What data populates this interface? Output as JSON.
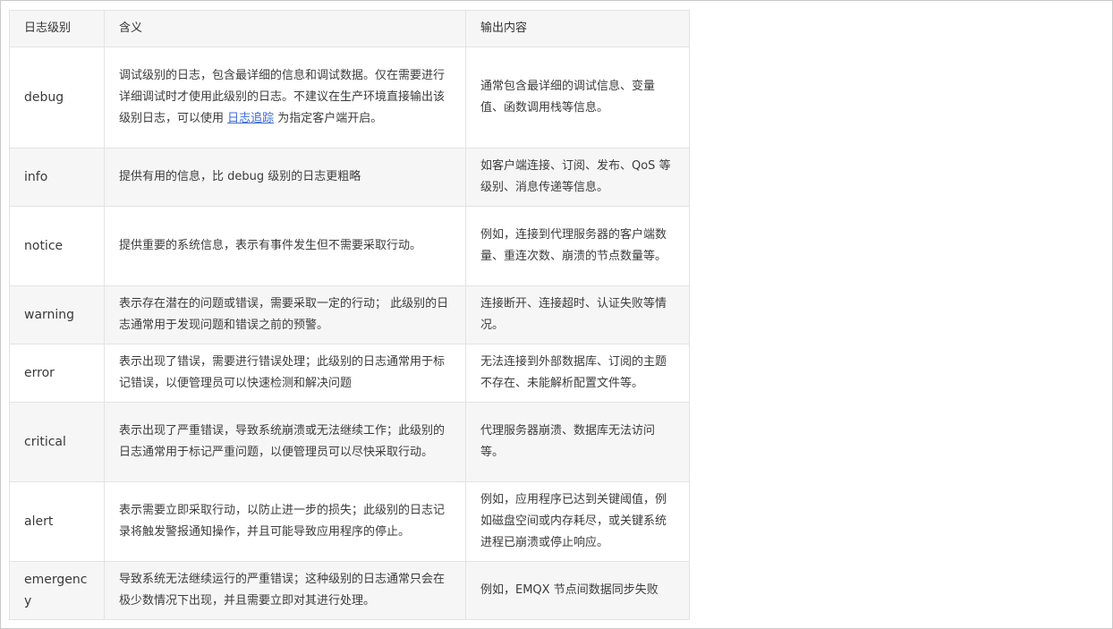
{
  "table": {
    "headers": [
      "日志级别",
      "含义",
      "输出内容"
    ],
    "rows": [
      {
        "level": "debug",
        "meaning_before": "调试级别的日志，包含最详细的信息和调试数据。仅在需要进行详细调试时才使用此级别的日志。不建议在生产环境直接输出该级别日志，可以使用 ",
        "meaning_link": "日志追踪",
        "meaning_after": " 为指定客户端开启。",
        "output": "通常包含最详细的调试信息、变量值、函数调用栈等信息。"
      },
      {
        "level": "info",
        "meaning": "提供有用的信息，比 debug 级别的日志更粗略",
        "output": "如客户端连接、订阅、发布、QoS 等级别、消息传递等信息。"
      },
      {
        "level": "notice",
        "meaning": "提供重要的系统信息，表示有事件发生但不需要采取行动。",
        "output": "例如，连接到代理服务器的客户端数量、重连次数、崩溃的节点数量等。"
      },
      {
        "level": "warning",
        "meaning": "表示存在潜在的问题或错误，需要采取一定的行动； 此级别的日志通常用于发现问题和错误之前的预警。",
        "output": "连接断开、连接超时、认证失败等情况。"
      },
      {
        "level": "error",
        "meaning": "表示出现了错误，需要进行错误处理；此级别的日志通常用于标记错误，以便管理员可以快速检测和解决问题",
        "output": "无法连接到外部数据库、订阅的主题不存在、未能解析配置文件等。"
      },
      {
        "level": "critical",
        "meaning": "表示出现了严重错误，导致系统崩溃或无法继续工作；此级别的日志通常用于标记严重问题，以便管理员可以尽快采取行动。",
        "output": "代理服务器崩溃、数据库无法访问等。"
      },
      {
        "level": "alert",
        "meaning": "表示需要立即采取行动，以防止进一步的损失；此级别的日志记录将触发警报通知操作，并且可能导致应用程序的停止。",
        "output": "例如，应用程序已达到关键阈值，例如磁盘空间或内存耗尽，或关键系统进程已崩溃或停止响应。"
      },
      {
        "level": "emergency",
        "meaning": "导致系统无法继续运行的严重错误；这种级别的日志通常只会在极少数情况下出现，并且需要立即对其进行处理。",
        "output": "例如，EMQX 节点间数据同步失败"
      }
    ]
  }
}
